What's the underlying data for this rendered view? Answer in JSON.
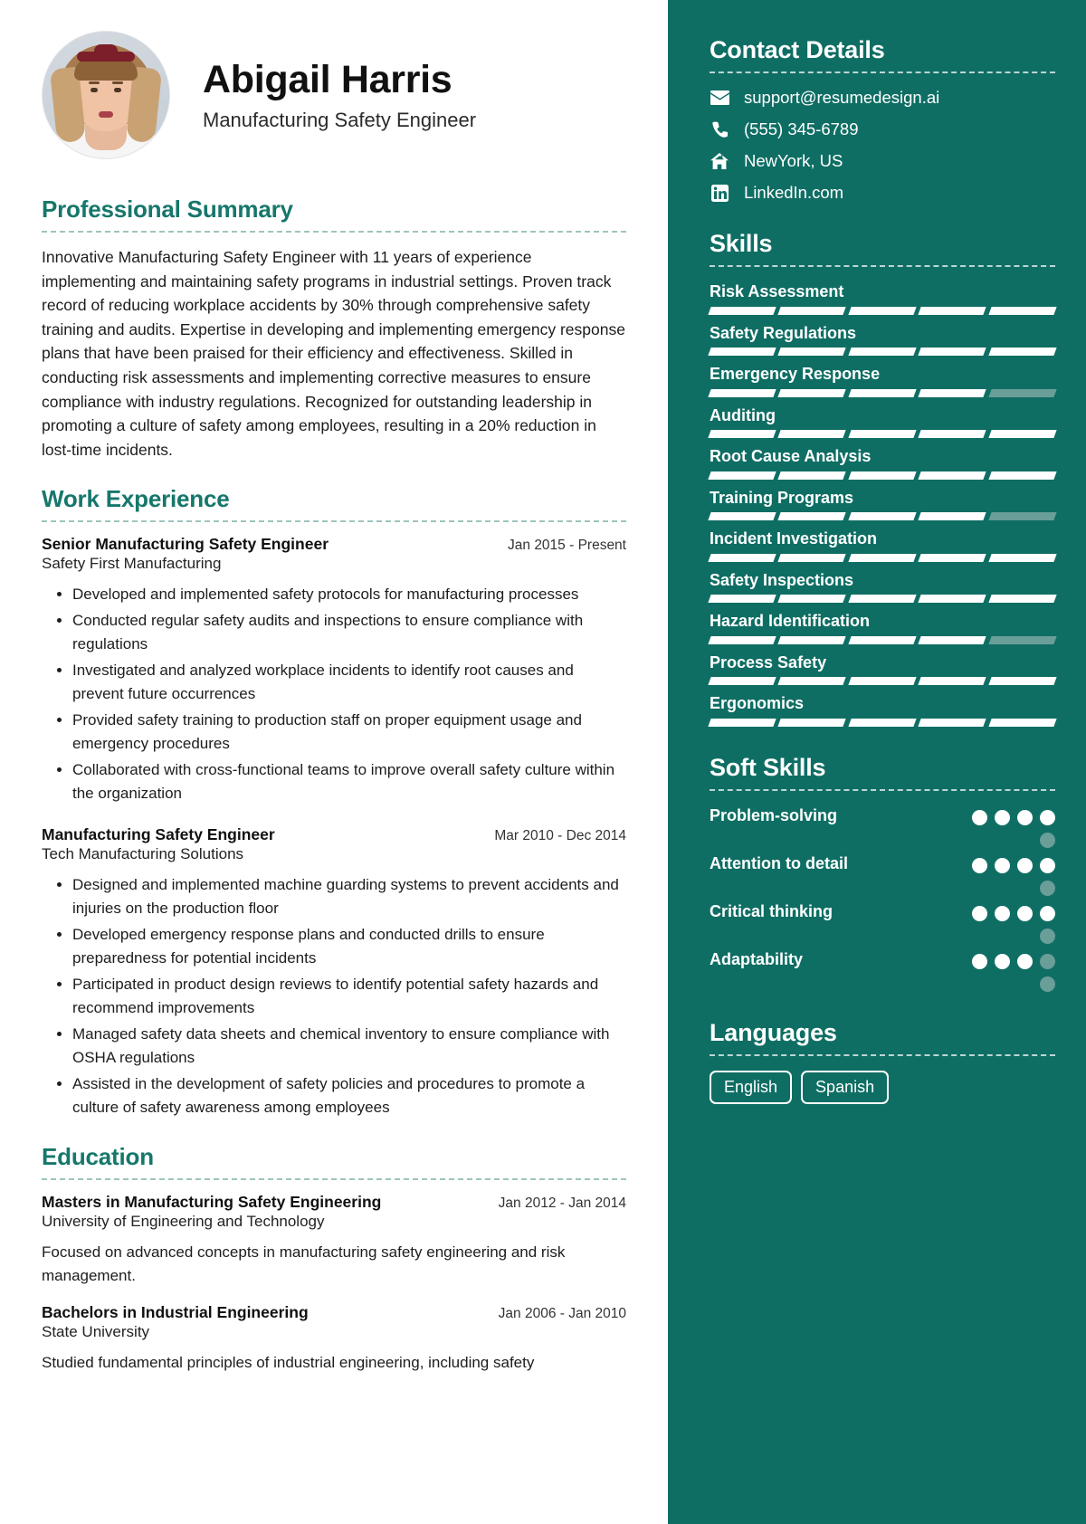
{
  "theme": {
    "accent": "#16776b",
    "sidebar_bg": "#0f6e64",
    "bar_on": "#ffffff",
    "bar_off": "#6a9e98",
    "text": "#1d1d1d"
  },
  "header": {
    "name": "Abigail Harris",
    "role": "Manufacturing Safety Engineer",
    "avatar_alt": "profile-photo"
  },
  "summary": {
    "title": "Professional Summary",
    "text": "Innovative Manufacturing Safety Engineer with 11 years of experience implementing and maintaining safety programs in industrial settings. Proven track record of reducing workplace accidents by 30% through comprehensive safety training and audits. Expertise in developing and implementing emergency response plans that have been praised for their efficiency and effectiveness. Skilled in conducting risk assessments and implementing corrective measures to ensure compliance with industry regulations. Recognized for outstanding leadership in promoting a culture of safety among employees, resulting in a 20% reduction in lost-time incidents."
  },
  "work": {
    "title": "Work Experience",
    "jobs": [
      {
        "title": "Senior Manufacturing Safety Engineer",
        "date": "Jan 2015 - Present",
        "org": "Safety First Manufacturing",
        "bullets": [
          "Developed and implemented safety protocols for manufacturing processes",
          "Conducted regular safety audits and inspections to ensure compliance with regulations",
          "Investigated and analyzed workplace incidents to identify root causes and prevent future occurrences",
          "Provided safety training to production staff on proper equipment usage and emergency procedures",
          "Collaborated with cross-functional teams to improve overall safety culture within the organization"
        ]
      },
      {
        "title": "Manufacturing Safety Engineer",
        "date": "Mar 2010 - Dec 2014",
        "org": "Tech Manufacturing Solutions",
        "bullets": [
          "Designed and implemented machine guarding systems to prevent accidents and injuries on the production floor",
          "Developed emergency response plans and conducted drills to ensure preparedness for potential incidents",
          "Participated in product design reviews to identify potential safety hazards and recommend improvements",
          "Managed safety data sheets and chemical inventory to ensure compliance with OSHA regulations",
          "Assisted in the development of safety policies and procedures to promote a culture of safety awareness among employees"
        ]
      }
    ]
  },
  "education": {
    "title": "Education",
    "items": [
      {
        "degree": "Masters in Manufacturing Safety Engineering",
        "date": "Jan 2012 - Jan 2014",
        "school": "University of Engineering and Technology",
        "description": "Focused on advanced concepts in manufacturing safety engineering and risk management."
      },
      {
        "degree": "Bachelors in Industrial Engineering",
        "date": "Jan 2006 - Jan 2010",
        "school": "State University",
        "description": "Studied fundamental principles of industrial engineering, including safety"
      }
    ]
  },
  "contact": {
    "title": "Contact Details",
    "items": [
      {
        "icon": "envelope-icon",
        "value": "support@resumedesign.ai"
      },
      {
        "icon": "phone-icon",
        "value": "(555) 345-6789"
      },
      {
        "icon": "home-icon",
        "value": "NewYork, US"
      },
      {
        "icon": "linkedin-icon",
        "value": "LinkedIn.com"
      }
    ]
  },
  "skills": {
    "title": "Skills",
    "max": 5,
    "items": [
      {
        "name": "Risk Assessment",
        "level": 5
      },
      {
        "name": "Safety Regulations",
        "level": 5
      },
      {
        "name": "Emergency Response",
        "level": 4
      },
      {
        "name": "Auditing",
        "level": 5
      },
      {
        "name": "Root Cause Analysis",
        "level": 5
      },
      {
        "name": "Training Programs",
        "level": 4
      },
      {
        "name": "Incident Investigation",
        "level": 5
      },
      {
        "name": "Safety Inspections",
        "level": 5
      },
      {
        "name": "Hazard Identification",
        "level": 4
      },
      {
        "name": "Process Safety",
        "level": 5
      },
      {
        "name": "Ergonomics",
        "level": 5
      }
    ]
  },
  "soft_skills": {
    "title": "Soft Skills",
    "max": 5,
    "items": [
      {
        "name": "Problem-solving",
        "level": 4
      },
      {
        "name": "Attention to detail",
        "level": 4
      },
      {
        "name": "Critical thinking",
        "level": 4
      },
      {
        "name": "Adaptability",
        "level": 3
      }
    ]
  },
  "languages": {
    "title": "Languages",
    "items": [
      "English",
      "Spanish"
    ]
  }
}
